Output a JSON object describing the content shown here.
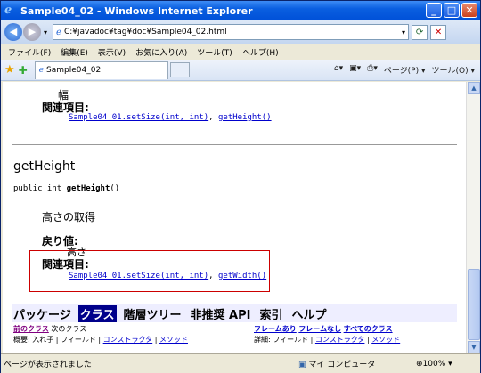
{
  "window": {
    "title": "Sample04_02 - Windows Internet Explorer",
    "min": "_",
    "max": "□",
    "close": "✕"
  },
  "address": {
    "url": "C:¥javadoc¥tag¥doc¥Sample04_02.html"
  },
  "menu": [
    "ファイル(F)",
    "編集(E)",
    "表示(V)",
    "お気に入り(A)",
    "ツール(T)",
    "ヘルプ(H)"
  ],
  "tab": {
    "label": "Sample04_02"
  },
  "tools": {
    "page": "ページ(P) ▾",
    "tool": "ツール(O) ▾"
  },
  "doc": {
    "width_desc": "幅",
    "related": "関連項目",
    "link_setsize": "Sample04_01.setSize(int, int)",
    "link_getheight": "getHeight()",
    "method_name": "getHeight",
    "sig_prefix": "public int ",
    "sig_name": "getHeight",
    "sig_suffix": "()",
    "desc": "高さの取得",
    "return_label": "戻り値",
    "return_val": "高さ",
    "related2": "関連項目",
    "link_getwidth": "getWidth()"
  },
  "navbar": {
    "pkg": "パッケージ",
    "cls": "クラス",
    "tree": "階層ツリー",
    "depr": "非推奨 API",
    "idx": "索引",
    "help": "ヘルプ"
  },
  "subnav": {
    "prev": "前のクラス",
    "next": "次のクラス",
    "frames": "フレームあり",
    "noframes": "フレームなし",
    "all": "すべてのクラス",
    "summary": "概要:",
    "nest": "入れ子",
    "field": "フィールド",
    "ctor": "コンストラクタ",
    "method": "メソッド",
    "detail": "詳細:",
    "field2": "フィールド",
    "ctor2": "コンストラクタ",
    "method2": "メソッド"
  },
  "status": {
    "text": "ページが表示されました",
    "zone": "マイ コンピュータ",
    "zoom": "100%"
  }
}
